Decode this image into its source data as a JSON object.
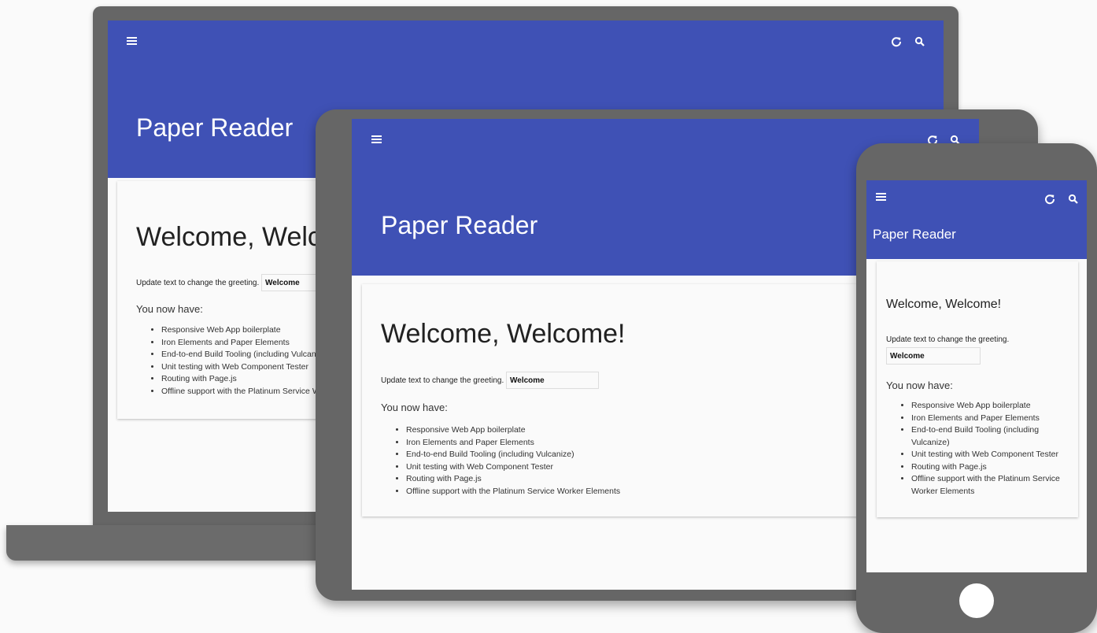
{
  "app": {
    "title": "Paper Reader",
    "header_color": "#3f51b5",
    "icons": {
      "menu": "menu-icon",
      "refresh": "refresh-icon",
      "search": "search-icon"
    }
  },
  "greeting": {
    "heading": "Welcome, Welcome!",
    "update_label": "Update text to change the greeting.",
    "input_value": "Welcome"
  },
  "features": {
    "intro": "You now have:",
    "items": [
      "Responsive Web App boilerplate",
      "Iron Elements and Paper Elements",
      "End-to-end Build Tooling (including Vulcanize)",
      "Unit testing with Web Component Tester",
      "Routing with Page.js",
      "Offline support with the Platinum Service Worker Elements"
    ]
  },
  "devices": [
    "laptop",
    "tablet",
    "phone"
  ]
}
